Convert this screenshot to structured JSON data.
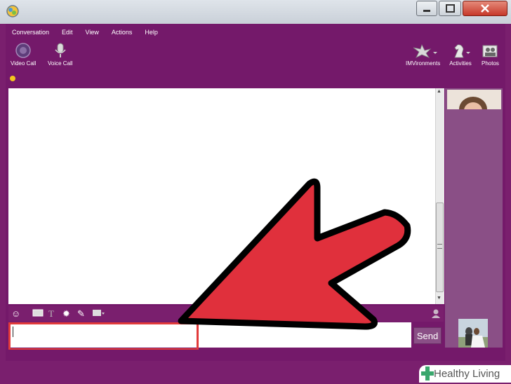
{
  "menu": [
    "Conversation",
    "Edit",
    "View",
    "Actions",
    "Help"
  ],
  "toolbar_left": [
    {
      "label": "Video Call",
      "icon": "video-call-icon"
    },
    {
      "label": "Voice Call",
      "icon": "microphone-icon"
    }
  ],
  "toolbar_right": [
    {
      "label": "IMVironments",
      "icon": "imvironments-icon"
    },
    {
      "label": "Activities",
      "icon": "chess-knight-icon"
    },
    {
      "label": "Photos",
      "icon": "photos-icon"
    }
  ],
  "composer": {
    "send_label": "Send",
    "value": ""
  },
  "formatting_icons": [
    "emoticon-icon",
    "wink-icon",
    "font-icon",
    "nudge-icon",
    "paperclip-icon",
    "background-icon",
    "contact-icon"
  ],
  "colors": {
    "frame": "#74196a",
    "panel": "#8a4f86",
    "highlight": "#e23b3b",
    "arrow": "#e0303c",
    "presence": "#f3c51e"
  },
  "watermark": {
    "text": "Healthy Living"
  }
}
